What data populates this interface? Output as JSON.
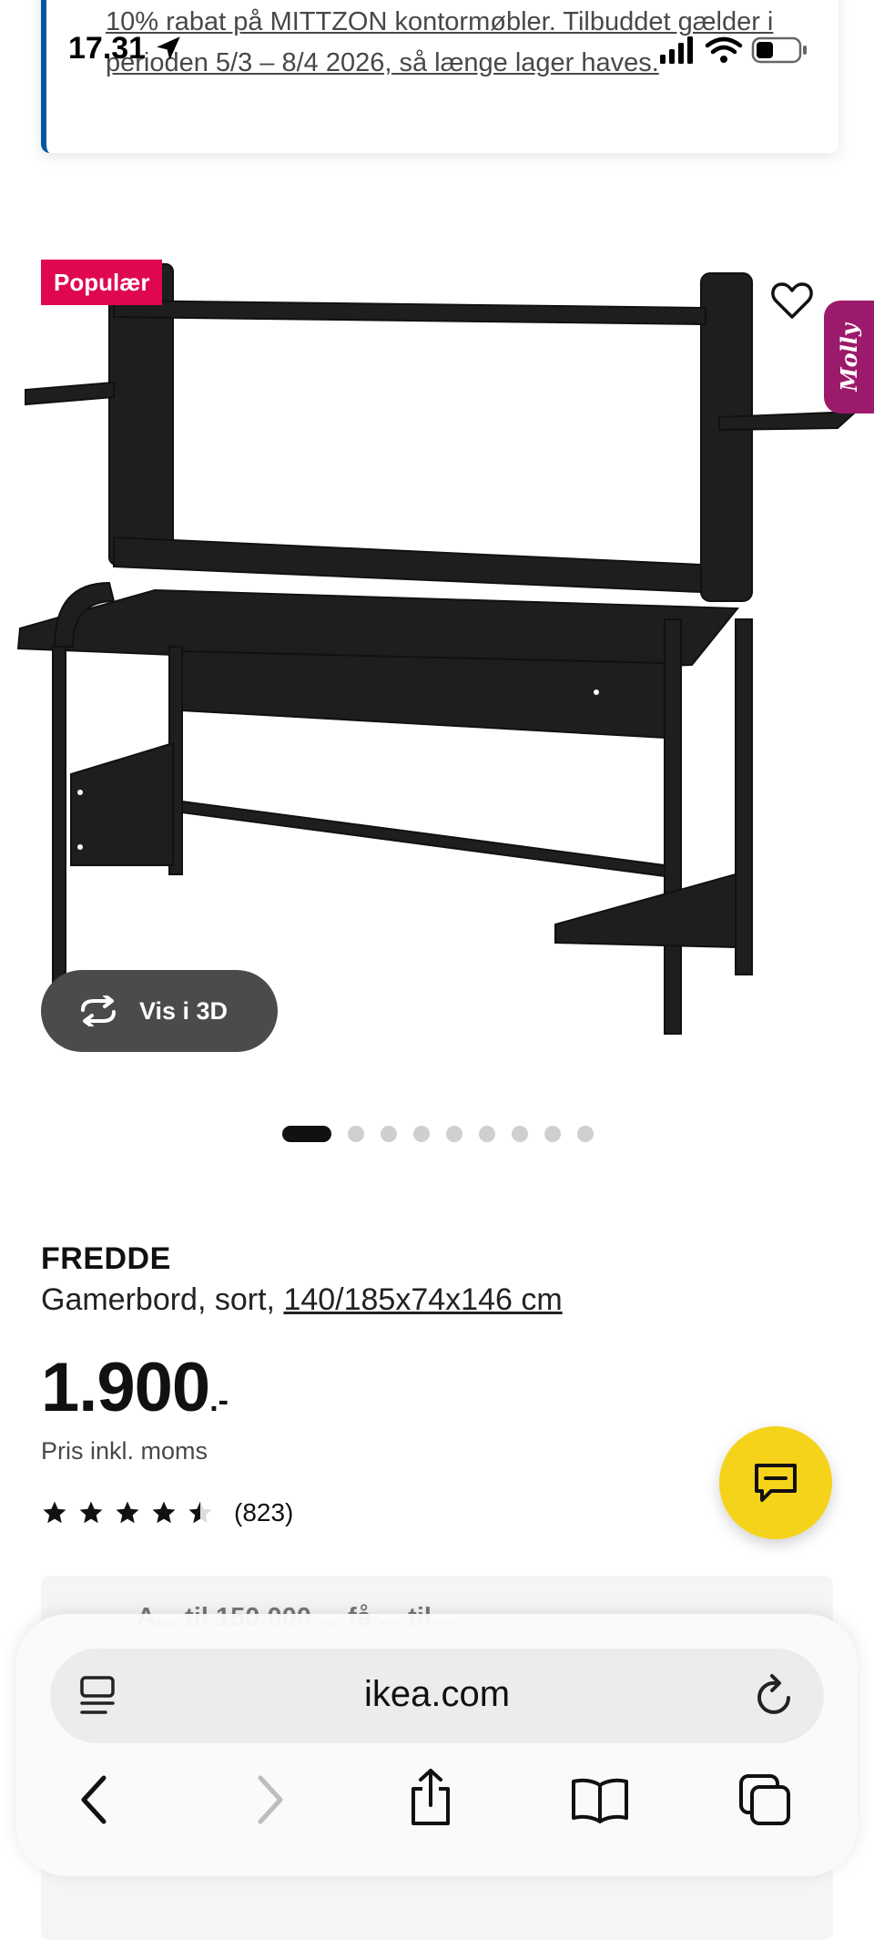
{
  "status_bar": {
    "time": "17.31"
  },
  "promo": {
    "text": "10% rabat på MITTZON kontormøbler. Tilbuddet gælder i perioden 5/3 – 8/4 2026, så længe lager haves."
  },
  "gallery": {
    "badge": "Populær",
    "molly_label": "Molly",
    "view_3d_label": "Vis i 3D",
    "image_count": 9,
    "active_index": 0
  },
  "product": {
    "name": "FREDDE",
    "description": "Gamerbord, sort,",
    "dimensions": "140/185x74x146 cm",
    "price_integer": "1.900",
    "price_suffix": ".-",
    "price_note": "Pris inkl. moms",
    "rating_value": 4.5,
    "rating_max": 5,
    "review_count": "(823)"
  },
  "credit_teaser": {
    "text": "A... til 150.000 ... få ... til..."
  },
  "browser": {
    "url": "ikea.com"
  },
  "colors": {
    "badge": "#e00751",
    "molly": "#9c1a6b",
    "chat": "#f5d31b",
    "promo_accent": "#0058a3"
  }
}
